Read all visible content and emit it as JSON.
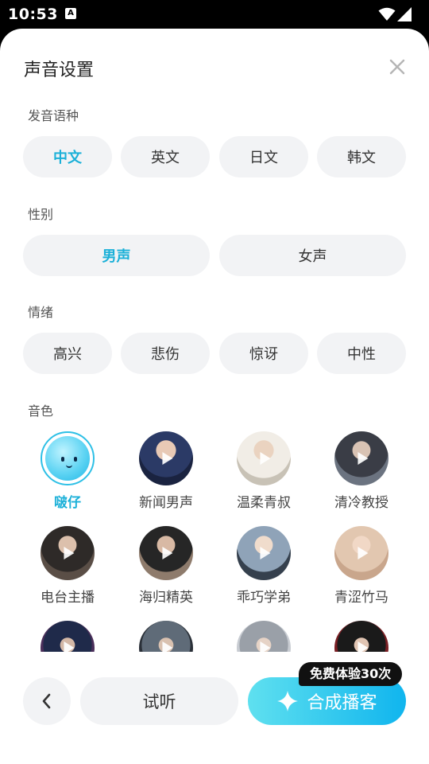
{
  "status_bar": {
    "time": "10:53",
    "notification_icon": "A"
  },
  "dialog": {
    "title": "声音设置",
    "close_icon": "close-icon",
    "language": {
      "label": "发音语种",
      "options": [
        "中文",
        "英文",
        "日文",
        "韩文"
      ],
      "selected": "中文"
    },
    "gender": {
      "label": "性别",
      "options": [
        "男声",
        "女声"
      ],
      "selected": "男声"
    },
    "emotion": {
      "label": "情绪",
      "options": [
        "高兴",
        "悲伤",
        "惊讶",
        "中性"
      ]
    },
    "timbre": {
      "label": "音色",
      "voices": [
        {
          "name": "啵仔",
          "selected": true
        },
        {
          "name": "新闻男声"
        },
        {
          "name": "温柔青叔"
        },
        {
          "name": "清冷教授"
        },
        {
          "name": "电台主播"
        },
        {
          "name": "海归精英"
        },
        {
          "name": "乖巧学弟"
        },
        {
          "name": "青涩竹马"
        },
        {
          "name": ""
        },
        {
          "name": ""
        },
        {
          "name": ""
        },
        {
          "name": ""
        }
      ]
    }
  },
  "footer": {
    "back_icon": "chevron-left-icon",
    "listen_label": "试听",
    "create_label": "合成播客",
    "create_icon": "sparkle-icon",
    "badge": "免费体验30次"
  },
  "colors": {
    "accent": "#1bb0d8",
    "pill_bg": "#f2f3f5",
    "button_gradient_start": "#5fe0ef",
    "button_gradient_end": "#10b5ee"
  }
}
